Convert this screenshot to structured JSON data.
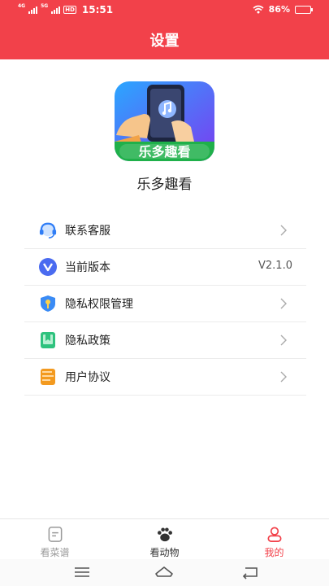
{
  "status_bar": {
    "time": "15:51",
    "network_1": "4G",
    "network_2": "5G",
    "hd_badge": "HD",
    "battery": "86%",
    "battery_level": 0.86
  },
  "header": {
    "title": "设置"
  },
  "app": {
    "name": "乐多趣看",
    "icon_banner_text": "乐多趣看"
  },
  "menu": [
    {
      "label": "联系客服",
      "icon": "headset-icon",
      "trailing": "chevron"
    },
    {
      "label": "当前版本",
      "icon": "version-icon",
      "trailing": "V2.1.0"
    },
    {
      "label": "隐私权限管理",
      "icon": "privacy-shield-icon",
      "trailing": "chevron"
    },
    {
      "label": "隐私政策",
      "icon": "policy-bookmark-icon",
      "trailing": "chevron"
    },
    {
      "label": "用户协议",
      "icon": "agreement-doc-icon",
      "trailing": "chevron"
    }
  ],
  "tabbar": [
    {
      "label": "看菜谱",
      "icon": "recipe-icon",
      "state": "inactive"
    },
    {
      "label": "看动物",
      "icon": "paw-icon",
      "state": "inactive"
    },
    {
      "label": "我的",
      "icon": "profile-icon",
      "state": "active"
    }
  ],
  "colors": {
    "brand_red": "#f2414a",
    "tab_inactive": "#9a9a9a",
    "tab_active": "#f2414a",
    "tab_dark": "#333333"
  }
}
